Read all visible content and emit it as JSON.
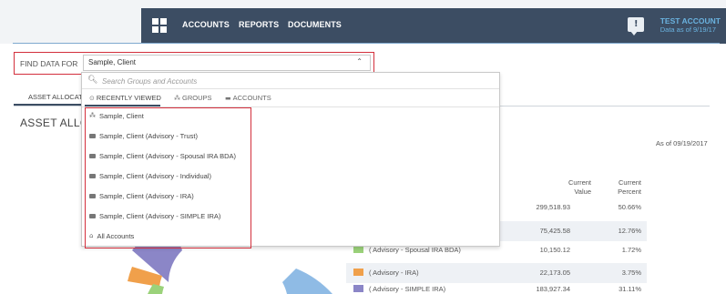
{
  "nav": {
    "links": [
      "ACCOUNTS",
      "REPORTS",
      "DOCUMENTS"
    ],
    "account_name": "TEST ACCOUNT",
    "account_date": "Data as of 9/19/17"
  },
  "find": {
    "label": "FIND DATA FOR",
    "selected": "Sample, Client"
  },
  "dropdown": {
    "search_placeholder": "Search Groups and Accounts",
    "tabs": [
      {
        "label": "RECENTLY VIEWED",
        "icon": "clock-icon"
      },
      {
        "label": "GROUPS",
        "icon": "group-icon"
      },
      {
        "label": "ACCOUNTS",
        "icon": "briefcase-icon"
      }
    ],
    "results": [
      {
        "label": "Sample, Client",
        "icon": "group-icon"
      },
      {
        "label": "Sample, Client (Advisory - Trust)",
        "icon": "briefcase-icon"
      },
      {
        "label": "Sample, Client (Advisory - Spousal IRA BDA)",
        "icon": "briefcase-icon"
      },
      {
        "label": "Sample, Client (Advisory - Individual)",
        "icon": "briefcase-icon"
      },
      {
        "label": "Sample, Client (Advisory - IRA)",
        "icon": "briefcase-icon"
      },
      {
        "label": "Sample, Client (Advisory - SIMPLE IRA)",
        "icon": "briefcase-icon"
      },
      {
        "label": "All Accounts",
        "icon": "home-icon"
      }
    ]
  },
  "page": {
    "tab_label": "ASSET ALLOCATION",
    "heading": "ASSET ALLOCATION",
    "as_of": "As of 09/19/2017",
    "col_value": [
      "Current",
      "Value"
    ],
    "col_percent": [
      "Current",
      "Percent"
    ],
    "rows": [
      {
        "label": "",
        "value": "299,518.93",
        "percent": "50.66%",
        "color": "#ffffff",
        "shade": false
      },
      {
        "label": "",
        "value": "75,425.58",
        "percent": "12.76%",
        "color": "#ffffff",
        "shade": true
      },
      {
        "label": "( Advisory - Spousal IRA BDA)",
        "value": "10,150.12",
        "percent": "1.72%",
        "color": "#9bd27a",
        "shade": false
      },
      {
        "label": "( Advisory - IRA)",
        "value": "22,173.05",
        "percent": "3.75%",
        "color": "#f0a04b",
        "shade": true
      },
      {
        "label": "( Advisory - SIMPLE IRA)",
        "value": "183,927.34",
        "percent": "31.11%",
        "color": "#8b86c7",
        "shade": false
      }
    ]
  },
  "colors": {
    "nav_bg": "#3c4d63",
    "highlight_border": "#d32f3c",
    "account_text": "#6ab3e0"
  }
}
